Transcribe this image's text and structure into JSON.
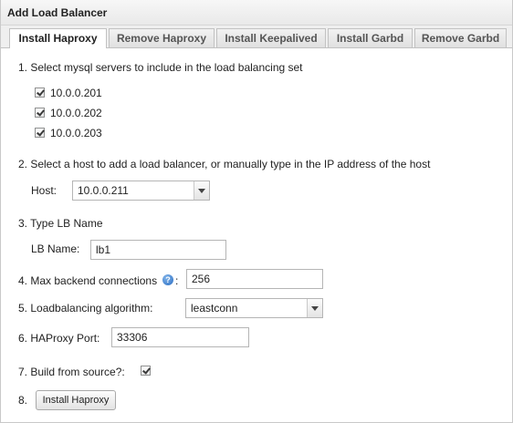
{
  "window": {
    "title": "Add Load Balancer"
  },
  "tabs": [
    {
      "label": "Install Haproxy",
      "active": true
    },
    {
      "label": "Remove Haproxy",
      "active": false
    },
    {
      "label": "Install Keepalived",
      "active": false
    },
    {
      "label": "Install Garbd",
      "active": false
    },
    {
      "label": "Remove Garbd",
      "active": false
    }
  ],
  "step1": {
    "label": "1. Select mysql servers to include in the load balancing set",
    "servers": [
      {
        "label": "10.0.0.201",
        "checked": true
      },
      {
        "label": "10.0.0.202",
        "checked": true
      },
      {
        "label": "10.0.0.203",
        "checked": true
      }
    ]
  },
  "step2": {
    "label": "2. Select a host to add a load balancer, or manually type in the IP address of the host",
    "host_label": "Host:",
    "host_value": "10.0.0.211"
  },
  "step3": {
    "label": "3. Type LB Name",
    "name_label": "LB Name:",
    "name_value": "lb1"
  },
  "step4": {
    "label": "4. Max backend connections",
    "colon": ":",
    "help_icon": "help-icon",
    "value": "256"
  },
  "step5": {
    "label": "5. Loadbalancing algorithm:",
    "value": "leastconn"
  },
  "step6": {
    "label": "6. HAProxy Port:",
    "value": "33306"
  },
  "step7": {
    "label": "7. Build from source?:",
    "checked": true
  },
  "step8": {
    "label": "8.",
    "button_label": "Install Haproxy"
  },
  "colors": {
    "help_icon": "#2c6fc4",
    "border": "#b5b5b5"
  }
}
